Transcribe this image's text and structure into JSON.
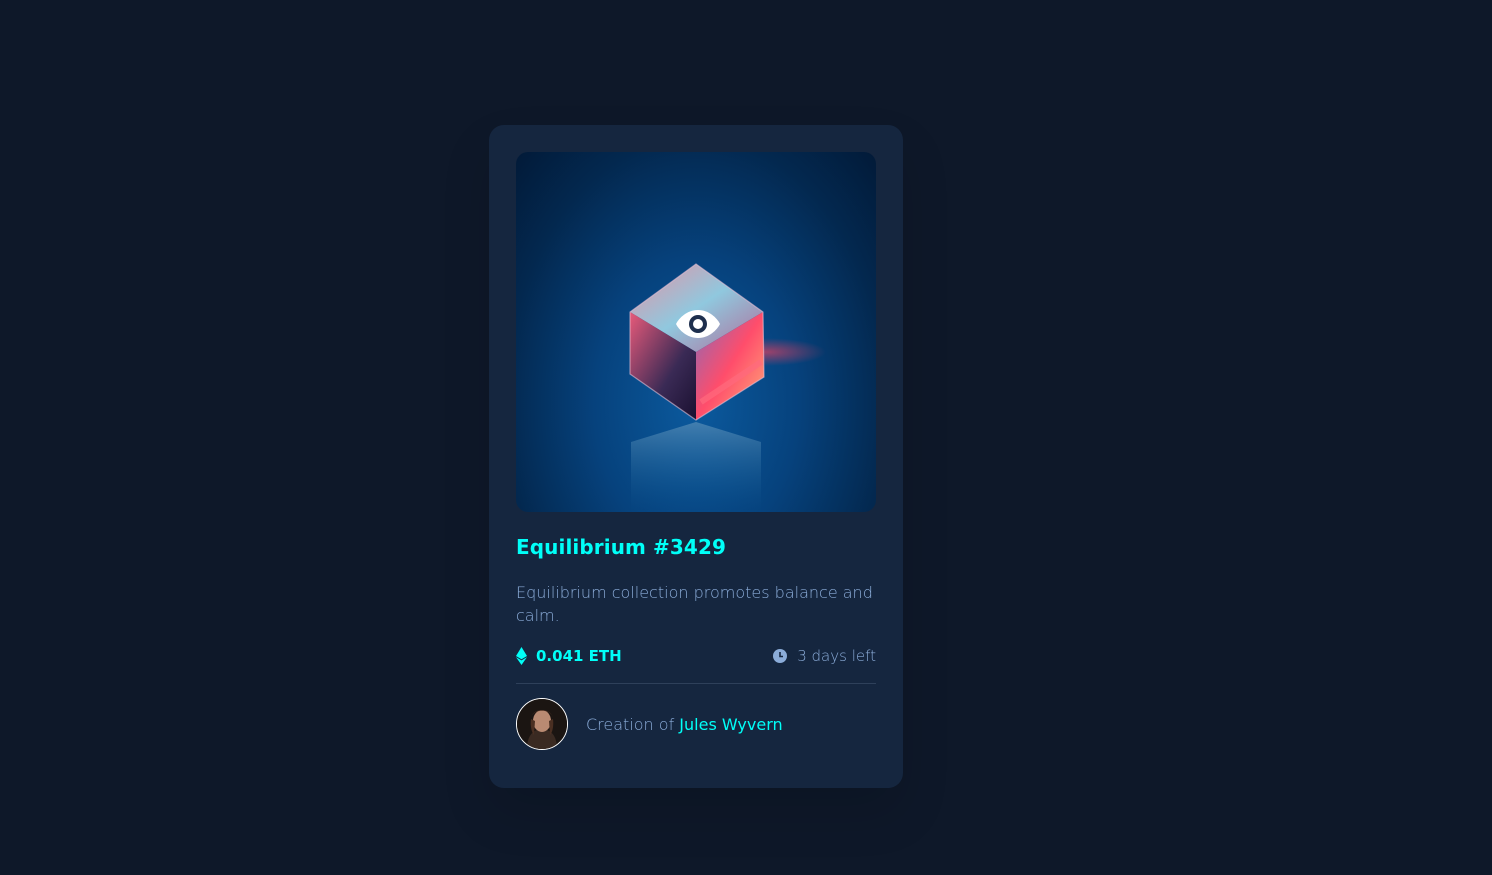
{
  "card": {
    "title": "Equilibrium #3429",
    "description": "Equilibrium collection promotes balance and calm.",
    "price": "0.041 ETH",
    "time_left": "3 days left",
    "creator_prefix": "Creation of ",
    "creator_name": "Jules Wyvern"
  },
  "icons": {
    "view": "eye-icon",
    "currency": "ethereum-icon",
    "time": "clock-icon"
  },
  "colors": {
    "background": "#0e1829",
    "card": "#15263f",
    "accent": "#00fff8",
    "muted_text": "#8bacd9",
    "divider": "#2e405a"
  }
}
